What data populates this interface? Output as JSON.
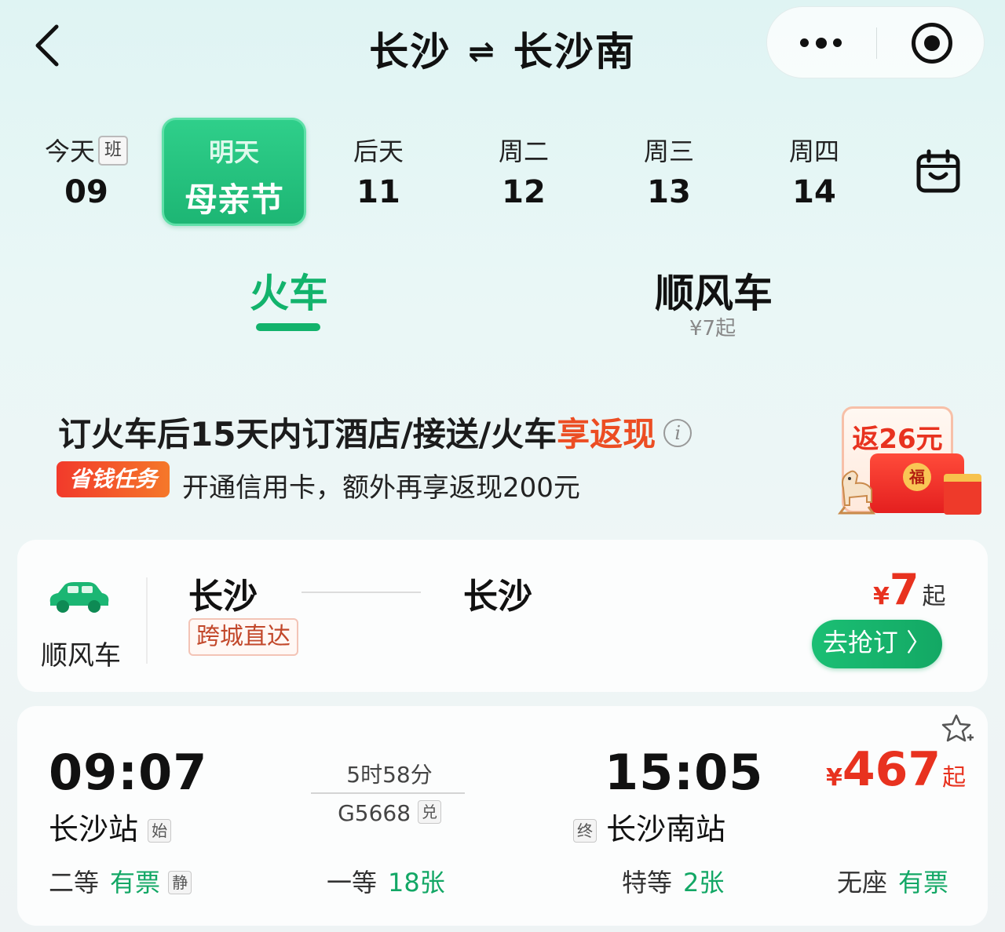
{
  "header": {
    "from": "长沙",
    "swap": "⇌",
    "to": "长沙南"
  },
  "dates": [
    {
      "weekday": "今天",
      "day": "09",
      "tag": "班"
    },
    {
      "weekday": "明天",
      "day": "母亲节",
      "selected": true
    },
    {
      "weekday": "后天",
      "day": "11"
    },
    {
      "weekday": "周二",
      "day": "12"
    },
    {
      "weekday": "周三",
      "day": "13"
    },
    {
      "weekday": "周四",
      "day": "14"
    }
  ],
  "tabs": {
    "train": "火车",
    "ride": "顺风车",
    "ride_sub": "¥7起"
  },
  "promo": {
    "title_main": "订火车后15天内订酒店/接送/火车",
    "title_highlight": "享返现",
    "info": "i",
    "badge": "省钱任务",
    "sub": "开通信用卡，额外再享返现200元",
    "packet_label": "返26元",
    "packet_fu": "福"
  },
  "ride_card": {
    "label": "顺风车",
    "from": "长沙",
    "to": "长沙",
    "tag": "跨城直达",
    "currency": "¥",
    "price": "7",
    "price_suffix": "起",
    "button": "去抢订 〉"
  },
  "train_card": {
    "dep_time": "09:07",
    "dep_station": "长沙站",
    "dep_tag": "始",
    "duration": "5时58分",
    "train_no": "G5668",
    "train_tag": "兑",
    "arr_time": "15:05",
    "arr_tag": "终",
    "arr_station": "长沙南站",
    "currency": "¥",
    "price": "467",
    "price_suffix": "起",
    "seats": [
      {
        "class": "二等",
        "avail": "有票",
        "tag": "静"
      },
      {
        "class": "一等",
        "avail": "18张"
      },
      {
        "class": "特等",
        "avail": "2张"
      },
      {
        "class": "无座",
        "avail": "有票"
      }
    ]
  },
  "colors": {
    "accent": "#12b36c",
    "price": "#e8321f",
    "highlight": "#ec4d23"
  }
}
